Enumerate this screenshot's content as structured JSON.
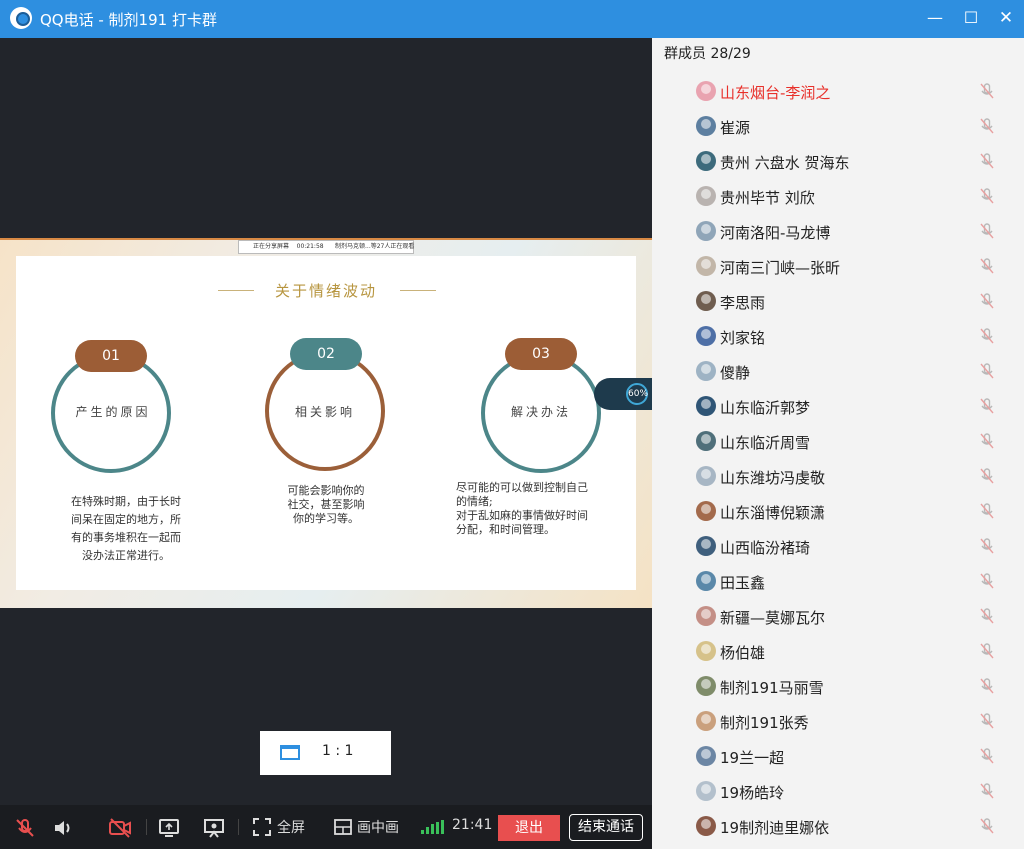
{
  "titlebar": {
    "title": "QQ电话 - 制剂191 打卡群",
    "minimize": "—",
    "maximize": "☐",
    "close": "✕"
  },
  "share_bar": {
    "text": "正在分享屏幕    00:21:58      制剂马克顿...等27人正在观看"
  },
  "slide": {
    "title": "关于情绪波动",
    "items": [
      {
        "num": "01",
        "label": "产生的原因",
        "text": [
          "在特殊时期，由于长时",
          "间呆在固定的地方，所",
          "有的事务堆积在一起而",
          "没办法正常进行。"
        ]
      },
      {
        "num": "02",
        "label": "相关影响",
        "text": [
          "可能会影响你的",
          "社交，甚至影响",
          "你的学习等。"
        ]
      },
      {
        "num": "03",
        "label": "解决办法",
        "text": [
          "尽可能的可以做到控制自己",
          "的情绪;",
          "对于乱如麻的事情做好时间",
          "分配，和时间管理。"
        ]
      }
    ],
    "gauge_value": "60%"
  },
  "zoom": {
    "ratio": "1 : 1"
  },
  "toolbar": {
    "fullscreen": "全屏",
    "pip": "画中画",
    "time": "21:41",
    "exit": "退出",
    "end_call": "结束通话"
  },
  "panel": {
    "header": "群成员 28/29",
    "members": [
      {
        "name": "山东烟台-李润之",
        "highlight": true,
        "color": "#e9a3b0"
      },
      {
        "name": "崔源",
        "highlight": false,
        "color": "#5d7fa0"
      },
      {
        "name": "贵州 六盘水 贺海东",
        "highlight": false,
        "color": "#3d6b7c"
      },
      {
        "name": "贵州毕节  刘欣",
        "highlight": false,
        "color": "#b9b3b0"
      },
      {
        "name": "河南洛阳-马龙博",
        "highlight": false,
        "color": "#8fa5b8"
      },
      {
        "name": "河南三门峡—张昕",
        "highlight": false,
        "color": "#c2b6a8"
      },
      {
        "name": "李思雨",
        "highlight": false,
        "color": "#6f5d4f"
      },
      {
        "name": "刘家铭",
        "highlight": false,
        "color": "#4e6fa6"
      },
      {
        "name": "傻静",
        "highlight": false,
        "color": "#9eb3c4"
      },
      {
        "name": "山东临沂郭梦",
        "highlight": false,
        "color": "#2f5576"
      },
      {
        "name": "山东临沂周雪",
        "highlight": false,
        "color": "#4f6f7a"
      },
      {
        "name": "山东潍坊冯虔敬",
        "highlight": false,
        "color": "#a7b6c4"
      },
      {
        "name": "山东淄博倪颖潇",
        "highlight": false,
        "color": "#a36a4c"
      },
      {
        "name": "山西临汾褚琦",
        "highlight": false,
        "color": "#3f5f7d"
      },
      {
        "name": "田玉鑫",
        "highlight": false,
        "color": "#5a88a9"
      },
      {
        "name": "新疆—莫娜瓦尔",
        "highlight": false,
        "color": "#c48f86"
      },
      {
        "name": "杨伯雄",
        "highlight": false,
        "color": "#d6c28a"
      },
      {
        "name": "制剂191马丽雪",
        "highlight": false,
        "color": "#7f8c6a"
      },
      {
        "name": "制剂191张秀",
        "highlight": false,
        "color": "#caa07d"
      },
      {
        "name": "19兰一超",
        "highlight": false,
        "color": "#6c86a4"
      },
      {
        "name": "19杨皓玲",
        "highlight": false,
        "color": "#b3c0cc"
      },
      {
        "name": "19制剂迪里娜依",
        "highlight": false,
        "color": "#8a5a48"
      }
    ]
  }
}
